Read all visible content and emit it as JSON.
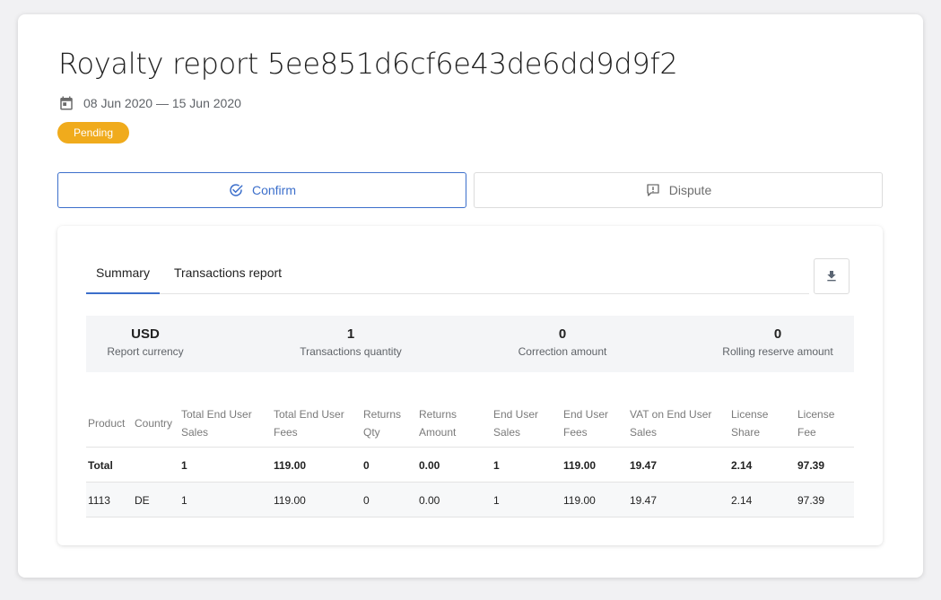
{
  "report": {
    "title": "Royalty report 5ee851d6cf6e43de6dd9d9f2",
    "date_range": "08 Jun 2020 — 15 Jun 2020",
    "status": "Pending",
    "status_color": "#f0ab1c"
  },
  "actions": {
    "confirm_label": "Confirm",
    "dispute_label": "Dispute",
    "accent_color": "#3c6fcb"
  },
  "tabs": [
    {
      "label": "Summary",
      "active": true
    },
    {
      "label": "Transactions report",
      "active": false
    }
  ],
  "icons": {
    "date": "calendar-icon",
    "confirm": "check-circle-icon",
    "dispute": "feedback-icon",
    "download": "download-icon"
  },
  "summary": [
    {
      "value": "USD",
      "label": "Report currency"
    },
    {
      "value": "1",
      "label": "Transactions quantity"
    },
    {
      "value": "0",
      "label": "Correction amount"
    },
    {
      "value": "0",
      "label": "Rolling reserve amount"
    }
  ],
  "table": {
    "headers": [
      "Product",
      "Country",
      "Total End User Sales",
      "Total End User Fees",
      "Returns Qty",
      "Returns Amount",
      "End User Sales",
      "End User Fees",
      "VAT on End User Sales",
      "License Share",
      "License Fee"
    ],
    "rows": [
      [
        "Total",
        "",
        "1",
        "119.00",
        "0",
        "0.00",
        "1",
        "119.00",
        "19.47",
        "2.14",
        "97.39"
      ],
      [
        "1113",
        "DE",
        "1",
        "119.00",
        "0",
        "0.00",
        "1",
        "119.00",
        "19.47",
        "2.14",
        "97.39"
      ]
    ]
  }
}
